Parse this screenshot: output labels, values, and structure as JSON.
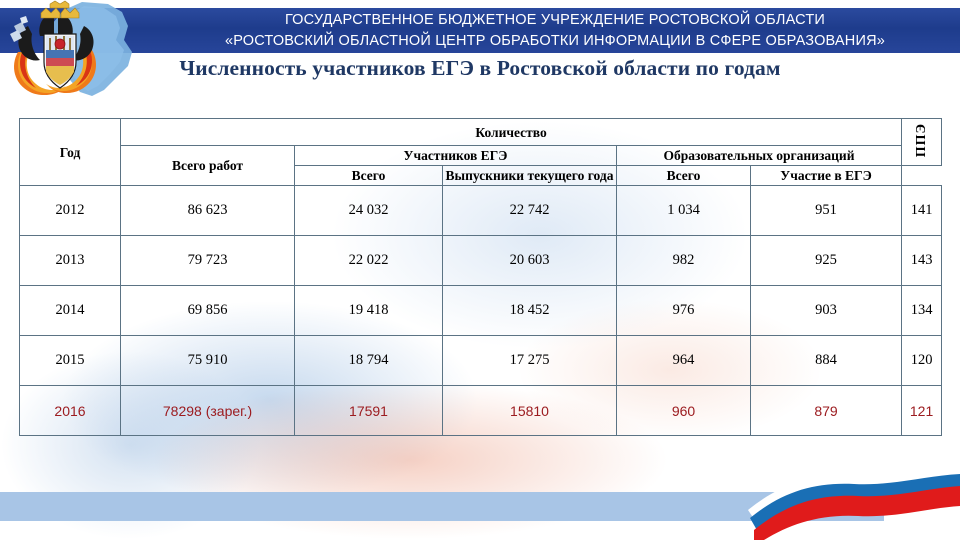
{
  "header": {
    "banner_line_1": "ГОСУДАРСТВЕННОЕ БЮДЖЕТНОЕ УЧРЕЖДЕНИЕ РОСТОВСКОЙ ОБЛАСТИ",
    "banner_line_2": "«РОСТОВСКИЙ ОБЛАСТНОЙ ЦЕНТР ОБРАБОТКИ ИНФОРМАЦИИ В СФЕРЕ ОБРАЗОВАНИЯ»",
    "logo_icon": "rostov-oblast-coat-of-arms-icon",
    "banner_color": "#1e3c8c",
    "title_color": "#1f3864"
  },
  "page_title": "Численность участников ЕГЭ в Ростовской области по годам",
  "table": {
    "headers": {
      "year": "Год",
      "quantity": "Количество",
      "total_works": "Всего работ",
      "participants": "Участников ЕГЭ",
      "participants_total": "Всего",
      "participants_graduates": "Выпускники текущего года",
      "organizations": "Образовательных организаций",
      "organizations_total": "Всего",
      "organizations_in_ege": "Участие в ЕГЭ",
      "ppe": "ППЭ"
    },
    "rows": [
      {
        "year": "2012",
        "total_works": "86 623",
        "participants_total": "24 032",
        "participants_graduates": "22 742",
        "organizations_total": "1 034",
        "organizations_in_ege": "951",
        "ppe": "141",
        "highlight": false
      },
      {
        "year": "2013",
        "total_works": "79 723",
        "participants_total": "22 022",
        "participants_graduates": "20 603",
        "organizations_total": "982",
        "organizations_in_ege": "925",
        "ppe": "143",
        "highlight": false
      },
      {
        "year": "2014",
        "total_works": "69 856",
        "participants_total": "19 418",
        "participants_graduates": "18 452",
        "organizations_total": "976",
        "organizations_in_ege": "903",
        "ppe": "134",
        "highlight": false
      },
      {
        "year": "2015",
        "total_works": "75 910",
        "participants_total": "18 794",
        "participants_graduates": "17 275",
        "organizations_total": "964",
        "organizations_in_ege": "884",
        "ppe": "120",
        "highlight": false
      },
      {
        "year": "2016",
        "total_works": "78298 (зарег.)",
        "participants_total": "17591",
        "participants_graduates": "15810",
        "organizations_total": "960",
        "organizations_in_ege": "879",
        "ppe": "121",
        "highlight": true
      }
    ],
    "highlight_color": "#9c1c20",
    "border_color": "#5b7384"
  },
  "decoration": {
    "bottom_bar_color": "#a8c5e6",
    "flag_ribbon_icon": "russian-flag-ribbon-icon",
    "flag_white": "#ffffff",
    "flag_blue": "#1a6fb5",
    "flag_red": "#e01b1b"
  }
}
